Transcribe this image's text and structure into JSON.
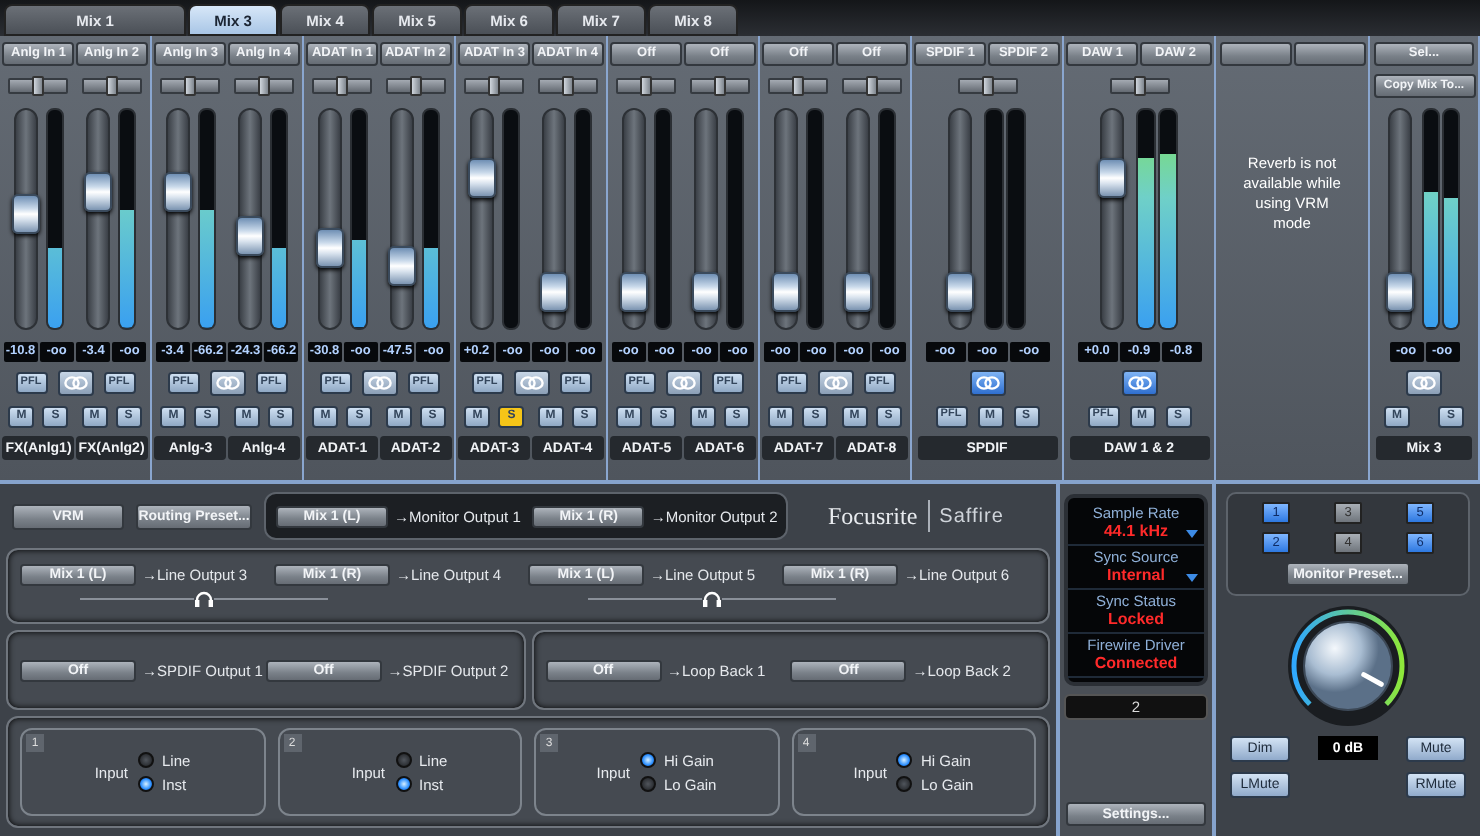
{
  "tabs": [
    {
      "label": "Mix 1",
      "selected": false
    },
    {
      "label": "Mix 3",
      "selected": true
    },
    {
      "label": "Mix 4",
      "selected": false
    },
    {
      "label": "Mix 5",
      "selected": false
    },
    {
      "label": "Mix 6",
      "selected": false
    },
    {
      "label": "Mix 7",
      "selected": false
    },
    {
      "label": "Mix 8",
      "selected": false
    }
  ],
  "strips": [
    {
      "kind": "pair",
      "linked": false,
      "channels": [
        {
          "source": "Anlg In 1",
          "pan": {
            "level": 0.5
          },
          "fader": {
            "level": 0.53
          },
          "meter": {
            "level": 0.37
          },
          "readings": [
            "-10.8",
            "-oo"
          ],
          "pfl": {
            "label": "PFL",
            "on": false
          },
          "mute": {
            "label": "M",
            "on": false
          },
          "solo": {
            "label": "S",
            "on": false
          },
          "label": "FX(Anlg1)"
        },
        {
          "source": "Anlg In 2",
          "pan": {
            "level": 0.5
          },
          "fader": {
            "level": 0.65
          },
          "meter": {
            "level": 0.54
          },
          "readings": [
            "-3.4",
            "-oo"
          ],
          "pfl": {
            "label": "PFL",
            "on": false
          },
          "mute": {
            "label": "M",
            "on": false
          },
          "solo": {
            "label": "S",
            "on": false
          },
          "label": "FX(Anlg2)"
        }
      ]
    },
    {
      "kind": "pair",
      "linked": false,
      "channels": [
        {
          "source": "Anlg In 3",
          "pan": {
            "level": 0.5
          },
          "fader": {
            "level": 0.65
          },
          "meter": {
            "level": 0.54
          },
          "readings": [
            "-3.4",
            "-66.2"
          ],
          "pfl": {
            "label": "PFL",
            "on": false
          },
          "mute": {
            "label": "M",
            "on": false
          },
          "solo": {
            "label": "S",
            "on": false
          },
          "label": "Anlg-3"
        },
        {
          "source": "Anlg In 4",
          "pan": {
            "level": 0.5
          },
          "fader": {
            "level": 0.4
          },
          "meter": {
            "level": 0.37
          },
          "readings": [
            "-24.3",
            "-66.2"
          ],
          "pfl": {
            "label": "PFL",
            "on": false
          },
          "mute": {
            "label": "M",
            "on": false
          },
          "solo": {
            "label": "S",
            "on": false
          },
          "label": "Anlg-4"
        }
      ]
    },
    {
      "kind": "pair",
      "linked": false,
      "channels": [
        {
          "source": "ADAT In 1",
          "pan": {
            "level": 0.5
          },
          "fader": {
            "level": 0.34
          },
          "meter": {
            "level": 0.4
          },
          "readings": [
            "-30.8",
            "-oo"
          ],
          "pfl": {
            "label": "PFL",
            "on": false
          },
          "mute": {
            "label": "M",
            "on": false
          },
          "solo": {
            "label": "S",
            "on": false
          },
          "label": "ADAT-1"
        },
        {
          "source": "ADAT In 2",
          "pan": {
            "level": 0.5
          },
          "fader": {
            "level": 0.24
          },
          "meter": {
            "level": 0.37
          },
          "readings": [
            "-47.5",
            "-oo"
          ],
          "pfl": {
            "label": "PFL",
            "on": false
          },
          "mute": {
            "label": "M",
            "on": false
          },
          "solo": {
            "label": "S",
            "on": false
          },
          "label": "ADAT-2"
        }
      ]
    },
    {
      "kind": "pair",
      "linked": false,
      "channels": [
        {
          "source": "ADAT In 3",
          "pan": {
            "level": 0.5
          },
          "fader": {
            "level": 0.73
          },
          "meter": {
            "level": 0
          },
          "readings": [
            "+0.2",
            "-oo"
          ],
          "pfl": {
            "label": "PFL",
            "on": false
          },
          "mute": {
            "label": "M",
            "on": false
          },
          "solo": {
            "label": "S",
            "on": true
          },
          "label": "ADAT-3"
        },
        {
          "source": "ADAT In 4",
          "pan": {
            "level": 0.5
          },
          "fader": {
            "level": 0.09
          },
          "meter": {
            "level": 0
          },
          "readings": [
            "-oo",
            "-oo"
          ],
          "pfl": {
            "label": "PFL",
            "on": false
          },
          "mute": {
            "label": "M",
            "on": false
          },
          "solo": {
            "label": "S",
            "on": false
          },
          "label": "ADAT-4"
        }
      ]
    },
    {
      "kind": "pair",
      "linked": false,
      "channels": [
        {
          "source": "Off",
          "pan": {
            "level": 0.5
          },
          "fader": {
            "level": 0.09
          },
          "meter": {
            "level": 0
          },
          "readings": [
            "-oo",
            "-oo"
          ],
          "pfl": {
            "label": "PFL",
            "on": false
          },
          "mute": {
            "label": "M",
            "on": false
          },
          "solo": {
            "label": "S",
            "on": false
          },
          "label": "ADAT-5"
        },
        {
          "source": "Off",
          "pan": {
            "level": 0.5
          },
          "fader": {
            "level": 0.09
          },
          "meter": {
            "level": 0
          },
          "readings": [
            "-oo",
            "-oo"
          ],
          "pfl": {
            "label": "PFL",
            "on": false
          },
          "mute": {
            "label": "M",
            "on": false
          },
          "solo": {
            "label": "S",
            "on": false
          },
          "label": "ADAT-6"
        }
      ]
    },
    {
      "kind": "pair",
      "linked": false,
      "channels": [
        {
          "source": "Off",
          "pan": {
            "level": 0.5
          },
          "fader": {
            "level": 0.09
          },
          "meter": {
            "level": 0
          },
          "readings": [
            "-oo",
            "-oo"
          ],
          "pfl": {
            "label": "PFL",
            "on": false
          },
          "mute": {
            "label": "M",
            "on": false
          },
          "solo": {
            "label": "S",
            "on": false
          },
          "label": "ADAT-7"
        },
        {
          "source": "Off",
          "pan": {
            "level": 0.5
          },
          "fader": {
            "level": 0.09
          },
          "meter": {
            "level": 0
          },
          "readings": [
            "-oo",
            "-oo"
          ],
          "pfl": {
            "label": "PFL",
            "on": false
          },
          "mute": {
            "label": "M",
            "on": false
          },
          "solo": {
            "label": "S",
            "on": false
          },
          "label": "ADAT-8"
        }
      ]
    },
    {
      "kind": "stereo",
      "sources": [
        "SPDIF 1",
        "SPDIF 2"
      ],
      "pan": {
        "level": 0.5
      },
      "fader": {
        "level": 0.09
      },
      "meters": [
        {
          "level": 0
        },
        {
          "level": 0
        }
      ],
      "readings": [
        "-oo",
        "-oo",
        "-oo"
      ],
      "linked": true,
      "pfl": {
        "label": "PFL",
        "on": false
      },
      "mute": {
        "label": "M",
        "on": false
      },
      "solo": {
        "label": "S",
        "on": false
      },
      "label": "SPDIF"
    },
    {
      "kind": "stereo",
      "sources": [
        "DAW 1",
        "DAW 2"
      ],
      "pan": {
        "level": 0.5
      },
      "fader": {
        "level": 0.73
      },
      "meters": [
        {
          "level": 0.78
        },
        {
          "level": 0.8
        }
      ],
      "readings": [
        "+0.0",
        "-0.9",
        "-0.8"
      ],
      "linked": true,
      "pfl": {
        "label": "PFL",
        "on": false
      },
      "mute": {
        "label": "M",
        "on": false
      },
      "solo": {
        "label": "S",
        "on": false
      },
      "label": "DAW 1 & 2"
    },
    {
      "kind": "message",
      "text": "Reverb is not available while using VRM mode"
    },
    {
      "kind": "master",
      "select": "Sel...",
      "copy": "Copy Mix To...",
      "fader": {
        "level": 0.09
      },
      "meters": [
        {
          "level": 0.62
        },
        {
          "level": 0.6
        }
      ],
      "readings": [
        "-oo",
        "-oo"
      ],
      "linked": false,
      "mute": {
        "label": "M",
        "on": false
      },
      "solo": {
        "label": "S",
        "on": false
      },
      "label": "Mix 3"
    }
  ],
  "routing": {
    "vrm": "VRM",
    "preset": "Routing Preset...",
    "monitor_outputs": [
      {
        "source": "Mix 1 (L)",
        "target": "→Monitor Output 1"
      },
      {
        "source": "Mix 1 (R)",
        "target": "→Monitor Output 2"
      }
    ],
    "brand": {
      "maker": "Focusrite",
      "product": "Saffire"
    },
    "line_outputs": [
      {
        "source": "Mix 1 (L)",
        "target": "→Line Output 3"
      },
      {
        "source": "Mix 1 (R)",
        "target": "→Line Output 4"
      },
      {
        "source": "Mix 1 (L)",
        "target": "→Line Output 5"
      },
      {
        "source": "Mix 1 (R)",
        "target": "→Line Output 6"
      }
    ],
    "spdif_outputs": [
      {
        "source": "Off",
        "target": "→SPDIF Output 1"
      },
      {
        "source": "Off",
        "target": "→SPDIF Output 2"
      }
    ],
    "loopbacks": [
      {
        "source": "Off",
        "target": "→Loop Back 1"
      },
      {
        "source": "Off",
        "target": "→Loop Back 2"
      }
    ]
  },
  "inputs": [
    {
      "number": "1",
      "caption": "Input",
      "options": [
        {
          "label": "Line",
          "selected": false
        },
        {
          "label": "Inst",
          "selected": true
        }
      ]
    },
    {
      "number": "2",
      "caption": "Input",
      "options": [
        {
          "label": "Line",
          "selected": false
        },
        {
          "label": "Inst",
          "selected": true
        }
      ]
    },
    {
      "number": "3",
      "caption": "Input",
      "options": [
        {
          "label": "Hi Gain",
          "selected": true
        },
        {
          "label": "Lo Gain",
          "selected": false
        }
      ]
    },
    {
      "number": "4",
      "caption": "Input",
      "options": [
        {
          "label": "Hi Gain",
          "selected": true
        },
        {
          "label": "Lo Gain",
          "selected": false
        }
      ]
    }
  ],
  "status": {
    "items": [
      {
        "label": "Sample Rate",
        "value": "44.1 kHz",
        "has_menu": true
      },
      {
        "label": "Sync Source",
        "value": "Internal",
        "has_menu": true
      },
      {
        "label": "Sync Status",
        "value": "Locked",
        "has_menu": false
      },
      {
        "label": "Firewire Driver",
        "value": "Connected",
        "has_menu": false
      }
    ],
    "field": "2",
    "settings": "Settings..."
  },
  "monitor": {
    "presets": [
      {
        "label": "1",
        "selected": true
      },
      {
        "label": "2",
        "selected": true
      },
      {
        "label": "3",
        "selected": false
      },
      {
        "label": "4",
        "selected": false
      },
      {
        "label": "5",
        "selected": true
      },
      {
        "label": "6",
        "selected": true
      }
    ],
    "preset_button": "Monitor Preset...",
    "knob": {
      "level": 0.94
    },
    "dim": "Dim",
    "readout": "0 dB",
    "mute": "Mute",
    "lmute": "LMute",
    "rmute": "RMute"
  }
}
